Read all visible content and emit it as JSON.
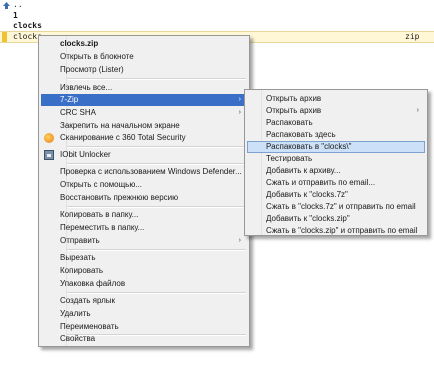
{
  "file_panel": {
    "rows": [
      {
        "name": "..",
        "ext": ""
      },
      {
        "name": "1",
        "ext": ""
      },
      {
        "name": "clocks",
        "ext": ""
      },
      {
        "name": "clocks",
        "ext": "zip"
      }
    ]
  },
  "context_menu": {
    "items": [
      {
        "label": "clocks.zip"
      },
      {
        "label": "Открыть в блокноте"
      },
      {
        "label": "Просмотр (Lister)"
      },
      {
        "label": "Извлечь все..."
      },
      {
        "label": "7-Zip"
      },
      {
        "label": "CRC SHA"
      },
      {
        "label": "Закрепить на начальном экране"
      },
      {
        "label": "Сканирование с 360 Total Security"
      },
      {
        "label": "IObit Unlocker"
      },
      {
        "label": "Проверка с использованием Windows Defender..."
      },
      {
        "label": "Открыть с помощью..."
      },
      {
        "label": "Восстановить прежнюю версию"
      },
      {
        "label": "Копировать в папку..."
      },
      {
        "label": "Переместить в папку..."
      },
      {
        "label": "Отправить"
      },
      {
        "label": "Вырезать"
      },
      {
        "label": "Копировать"
      },
      {
        "label": "Упаковка файлов"
      },
      {
        "label": "Создать ярлык"
      },
      {
        "label": "Удалить"
      },
      {
        "label": "Переименовать"
      },
      {
        "label": "Свойства"
      }
    ]
  },
  "submenu_7zip": {
    "items": [
      {
        "label": "Открыть архив"
      },
      {
        "label": "Открыть архив"
      },
      {
        "label": "Распаковать"
      },
      {
        "label": "Распаковать здесь"
      },
      {
        "label": "Распаковать в \"clocks\\\""
      },
      {
        "label": "Тестировать"
      },
      {
        "label": "Добавить к архиву..."
      },
      {
        "label": "Сжать и отправить по email..."
      },
      {
        "label": "Добавить к \"clocks.7z\""
      },
      {
        "label": "Сжать в \"clocks.7z\" и отправить по email"
      },
      {
        "label": "Добавить к \"clocks.zip\""
      },
      {
        "label": "Сжать в \"clocks.zip\" и отправить по email"
      }
    ]
  },
  "arrow_glyph": "›",
  "colors": {
    "highlight": "#3a6fc8",
    "hover": "#cce0f7",
    "selection_bar": "#f1c232"
  }
}
